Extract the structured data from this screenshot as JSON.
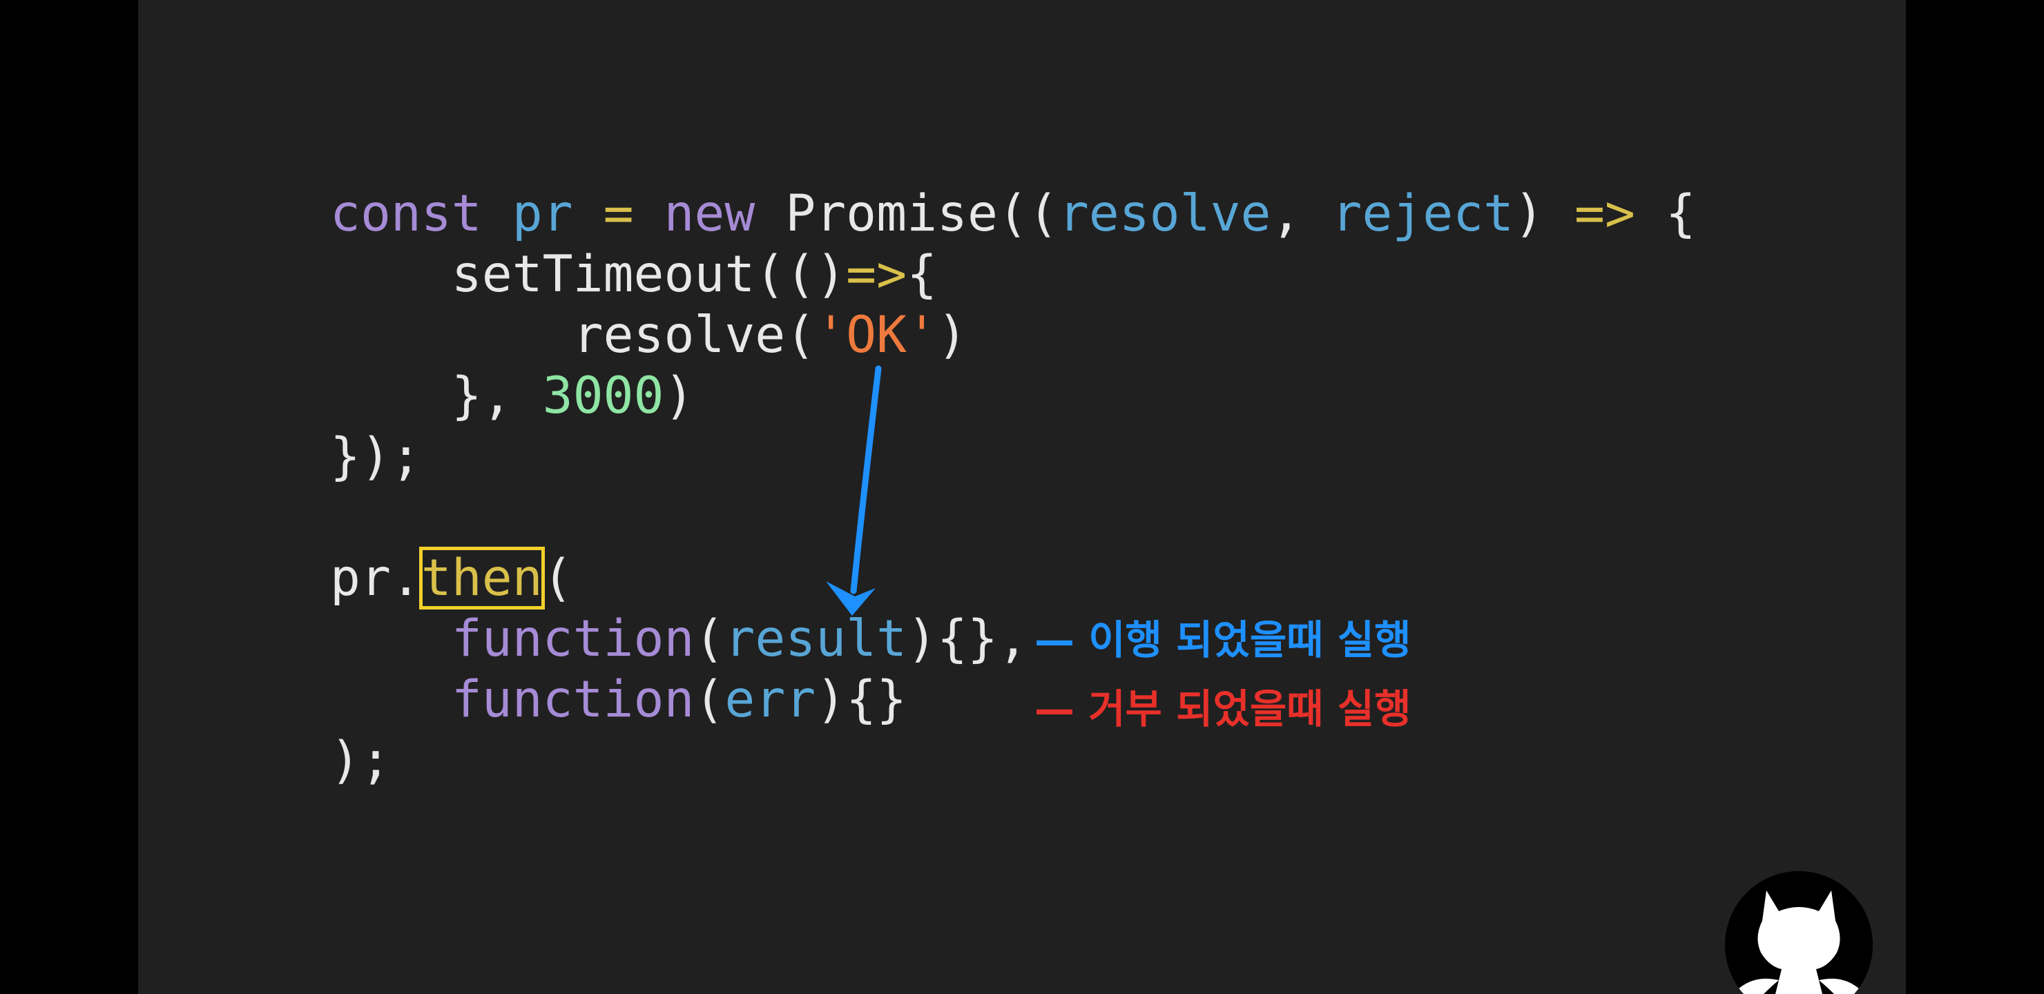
{
  "colors": {
    "background": "#202020",
    "letterbox": "#000000",
    "plain": "#e8e8e8",
    "keyword": "#a68bd6",
    "identifier": "#58a6d6",
    "operator": "#d9c04a",
    "string": "#ef7a3e",
    "number": "#8fe5a4",
    "highlight_box": "#f2d02b",
    "resolve_note": "#1e90ff",
    "reject_note": "#e8302a"
  },
  "code": {
    "lines": [
      [
        {
          "t": "const",
          "c": "keyword"
        },
        {
          "t": " ",
          "c": "plain"
        },
        {
          "t": "pr",
          "c": "identifier"
        },
        {
          "t": " ",
          "c": "plain"
        },
        {
          "t": "=",
          "c": "operator"
        },
        {
          "t": " ",
          "c": "plain"
        },
        {
          "t": "new",
          "c": "keyword"
        },
        {
          "t": " Promise((",
          "c": "plain"
        },
        {
          "t": "resolve",
          "c": "identifier"
        },
        {
          "t": ", ",
          "c": "plain"
        },
        {
          "t": "reject",
          "c": "identifier"
        },
        {
          "t": ") ",
          "c": "plain"
        },
        {
          "t": "=>",
          "c": "operator"
        },
        {
          "t": " {",
          "c": "plain"
        }
      ],
      [
        {
          "t": "    setTimeout(()",
          "c": "plain"
        },
        {
          "t": "=>",
          "c": "operator"
        },
        {
          "t": "{",
          "c": "plain"
        }
      ],
      [
        {
          "t": "        resolve(",
          "c": "plain"
        },
        {
          "t": "'OK'",
          "c": "string"
        },
        {
          "t": ")",
          "c": "plain"
        }
      ],
      [
        {
          "t": "    }, ",
          "c": "plain"
        },
        {
          "t": "3000",
          "c": "number"
        },
        {
          "t": ")",
          "c": "plain"
        }
      ],
      [
        {
          "t": "});",
          "c": "plain"
        }
      ],
      [],
      [
        {
          "t": "pr.",
          "c": "plain"
        },
        {
          "t": "then",
          "c": "operator",
          "boxed": true
        },
        {
          "t": "(",
          "c": "plain"
        }
      ],
      [
        {
          "t": "    ",
          "c": "plain"
        },
        {
          "t": "function",
          "c": "keyword"
        },
        {
          "t": "(",
          "c": "plain"
        },
        {
          "t": "result",
          "c": "identifier"
        },
        {
          "t": "){},",
          "c": "plain"
        }
      ],
      [
        {
          "t": "    ",
          "c": "plain"
        },
        {
          "t": "function",
          "c": "keyword"
        },
        {
          "t": "(",
          "c": "plain"
        },
        {
          "t": "err",
          "c": "identifier"
        },
        {
          "t": "){}",
          "c": "plain"
        }
      ],
      [
        {
          "t": ");",
          "c": "plain"
        }
      ]
    ]
  },
  "annotations": {
    "resolve_note": "— 이행 되었을때 실행",
    "reject_note": "— 거부 되었을때 실행"
  },
  "icons": {
    "arrow": "arrow-down-icon",
    "mascot": "devil-cat-mascot-icon"
  }
}
